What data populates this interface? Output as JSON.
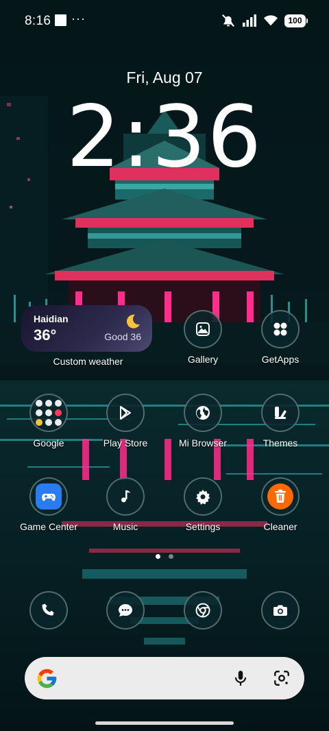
{
  "status_bar": {
    "time": "8:16",
    "overflow_dots": "···",
    "battery": "100"
  },
  "lockclock": {
    "date": "Fri, Aug 07",
    "time": "2:36"
  },
  "weather": {
    "city": "Haidian",
    "temperature": "36°",
    "air_quality": "Good 36",
    "icon": "moon-icon",
    "label": "Custom weather"
  },
  "apps": {
    "gallery": {
      "label": "Gallery",
      "icon": "image-icon"
    },
    "getapps": {
      "label": "GetApps",
      "icon": "grid-dots-icon"
    },
    "google": {
      "label": "Google",
      "icon": "folder-icon"
    },
    "playstore": {
      "label": "Play Store",
      "icon": "play-store-icon"
    },
    "mibrowser": {
      "label": "Mi Browser",
      "icon": "globe-icon"
    },
    "themes": {
      "label": "Themes",
      "icon": "brush-icon"
    },
    "gamecenter": {
      "label": "Game Center",
      "icon": "gamepad-icon"
    },
    "music": {
      "label": "Music",
      "icon": "music-note-icon"
    },
    "settings": {
      "label": "Settings",
      "icon": "gear-icon"
    },
    "cleaner": {
      "label": "Cleaner",
      "icon": "trash-icon"
    }
  },
  "dock": {
    "phone": {
      "icon": "phone-icon"
    },
    "messages": {
      "icon": "chat-icon"
    },
    "chrome": {
      "icon": "chrome-icon"
    },
    "camera": {
      "icon": "camera-icon"
    }
  },
  "page_indicator": {
    "pages": 2,
    "current": 1
  },
  "colors": {
    "accent_blue": "#2a7df0",
    "cleaner_orange": "#ff6a00",
    "weather_bg": "#2e2a4d",
    "search_bar": "#ececec"
  }
}
